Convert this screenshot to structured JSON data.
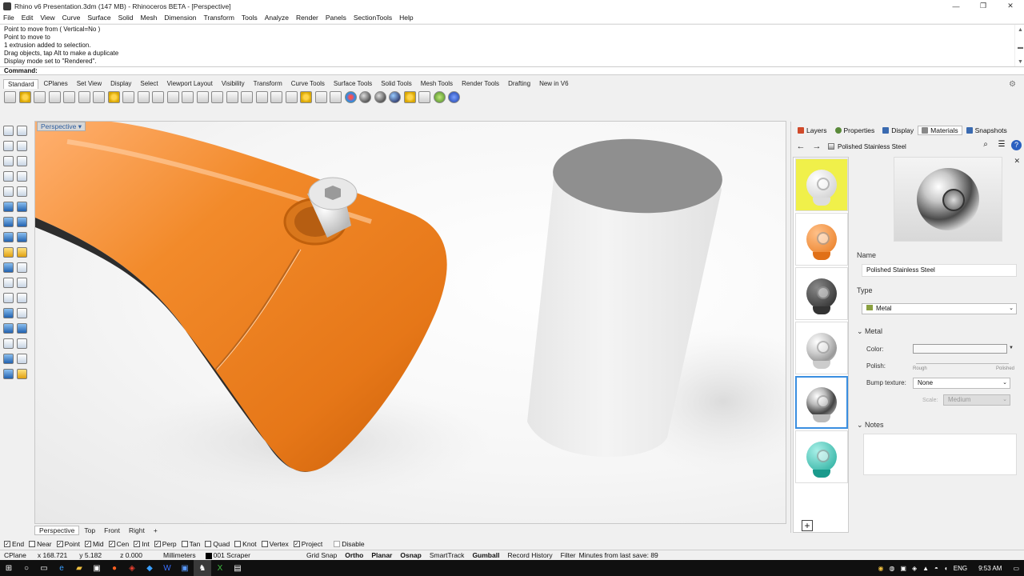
{
  "window": {
    "title": "Rhino v6 Presentation.3dm (147 MB) - Rhinoceros BETA - [Perspective]",
    "controls": [
      "—",
      "❐",
      "✕"
    ]
  },
  "menu": [
    "File",
    "Edit",
    "View",
    "Curve",
    "Surface",
    "Solid",
    "Mesh",
    "Dimension",
    "Transform",
    "Tools",
    "Analyze",
    "Render",
    "Panels",
    "SectionTools",
    "Help"
  ],
  "command_history": [
    "Point to move from ( Vertical=No )",
    "Point to move to",
    "1 extrusion added to selection.",
    "Drag objects, tap Alt to make a duplicate",
    "Display mode set to \"Rendered\"."
  ],
  "command_prompt": "Command:",
  "toolbar_tabs": [
    "Standard",
    "CPlanes",
    "Set View",
    "Display",
    "Select",
    "Viewport Layout",
    "Visibility",
    "Transform",
    "Curve Tools",
    "Surface Tools",
    "Solid Tools",
    "Mesh Tools",
    "Render Tools",
    "Drafting",
    "New in V6"
  ],
  "viewport": {
    "label": "Perspective",
    "tabs": [
      "Perspective",
      "Top",
      "Front",
      "Right"
    ],
    "add_tab": "+"
  },
  "osnaps": [
    {
      "label": "End",
      "checked": true
    },
    {
      "label": "Near",
      "checked": false
    },
    {
      "label": "Point",
      "checked": true
    },
    {
      "label": "Mid",
      "checked": true
    },
    {
      "label": "Cen",
      "checked": true
    },
    {
      "label": "Int",
      "checked": true
    },
    {
      "label": "Perp",
      "checked": true
    },
    {
      "label": "Tan",
      "checked": false
    },
    {
      "label": "Quad",
      "checked": false
    },
    {
      "label": "Knot",
      "checked": false
    },
    {
      "label": "Vertex",
      "checked": false
    },
    {
      "label": "Project",
      "checked": true
    },
    {
      "label": "Disable",
      "checked": false
    }
  ],
  "status": {
    "cplane": "CPlane",
    "x": "x 168.721",
    "y": "y 5.182",
    "z": "z 0.000",
    "units": "Millimeters",
    "layer": "001 Scraper",
    "grid_snap": "Grid Snap",
    "ortho": "Ortho",
    "planar": "Planar",
    "osnap": "Osnap",
    "smarttrack": "SmartTrack",
    "gumball": "Gumball",
    "record_history": "Record History",
    "filter": "Filter",
    "last_save": "Minutes from last save: 89"
  },
  "panel": {
    "tabs": [
      {
        "label": "Layers",
        "color": "#d04a2a"
      },
      {
        "label": "Properties",
        "color": "#5a8a3a"
      },
      {
        "label": "Display",
        "color": "#3a6ab0"
      },
      {
        "label": "Materials",
        "color": "#888888"
      },
      {
        "label": "Snapshots",
        "color": "#3a6ab0"
      }
    ],
    "active_tab": "Materials",
    "nav_back": "←",
    "nav_forward": "→",
    "current_material": "Polished Stainless Steel",
    "search_icon": "⌕",
    "menu_icon": "☰",
    "help_icon": "?",
    "close": "✕",
    "name_label": "Name",
    "name_value": "Polished Stainless Steel",
    "type_label": "Type",
    "type_value": "Metal",
    "metal_section": "Metal",
    "color_label": "Color:",
    "polish_label": "Polish:",
    "polish_min": "Rough",
    "polish_max": "Polished",
    "bump_label": "Bump texture:",
    "bump_value": "None",
    "scale_label": "Scale:",
    "scale_value": "Medium",
    "notes_section": "Notes",
    "add": "+"
  },
  "taskbar": {
    "lang": "ENG",
    "time": "9:53 AM"
  }
}
